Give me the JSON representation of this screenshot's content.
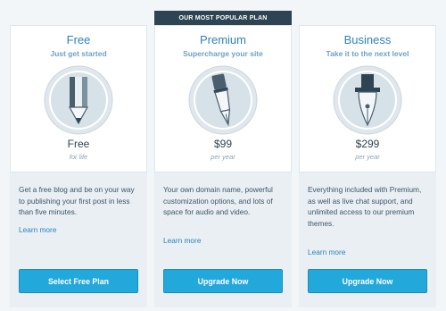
{
  "banner": "OUR MOST POPULAR PLAN",
  "colors": {
    "accent": "#2e82b9",
    "button": "#23a8dc",
    "banner": "#2e4453"
  },
  "plans": [
    {
      "name": "Free",
      "tagline": "Just get started",
      "icon": "pencil-icon",
      "price": "Free",
      "term": "for life",
      "description": "Get a free blog and be on your way to publishing your first post in less than five minutes.",
      "learn_more": "Learn more",
      "button": "Select Free Plan"
    },
    {
      "name": "Premium",
      "tagline": "Supercharge your site",
      "icon": "marker-pen-icon",
      "price": "$99",
      "term": "per year",
      "description": "Your own domain name, powerful customization options, and lots of space for audio and video.",
      "learn_more": "Learn more",
      "button": "Upgrade Now"
    },
    {
      "name": "Business",
      "tagline": "Take it to the next level",
      "icon": "fountain-pen-icon",
      "price": "$299",
      "term": "per year",
      "description": "Everything included with Premium, as well as live chat support, and unlimited access to our premium themes.",
      "learn_more": "Learn more",
      "button": "Upgrade Now"
    }
  ]
}
